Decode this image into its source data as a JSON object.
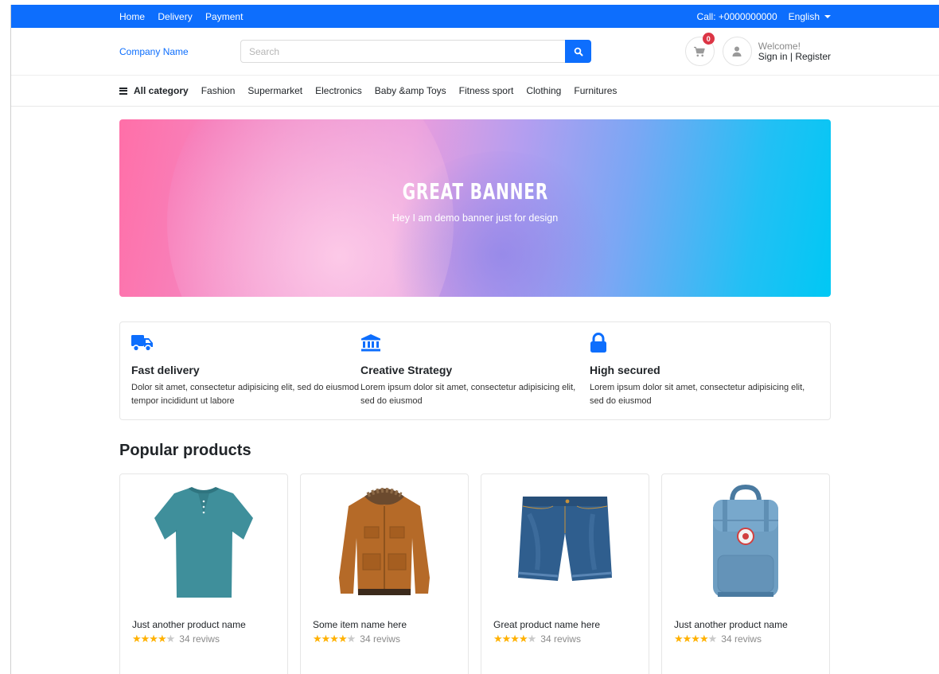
{
  "topbar": {
    "links": [
      "Home",
      "Delivery",
      "Payment"
    ],
    "call": "Call: +0000000000",
    "language": "English"
  },
  "header": {
    "brand": "Company Name",
    "search_placeholder": "Search",
    "cart_count": "0",
    "welcome": "Welcome!",
    "sign_in": "Sign in",
    "separator": "|",
    "register": "Register"
  },
  "categories": {
    "all": "All category",
    "items": [
      "Fashion",
      "Supermarket",
      "Electronics",
      "Baby &amp Toys",
      "Fitness sport",
      "Clothing",
      "Furnitures"
    ]
  },
  "banner": {
    "title": "GREAT BANNER",
    "subtitle": "Hey I am demo banner just for design"
  },
  "features": [
    {
      "icon": "truck-icon",
      "title": "Fast delivery",
      "desc": "Dolor sit amet, consectetur adipisicing elit, sed do eiusmod tempor incididunt ut labore"
    },
    {
      "icon": "bank-icon",
      "title": "Creative Strategy",
      "desc": "Lorem ipsum dolor sit amet, consectetur adipisicing elit, sed do eiusmod"
    },
    {
      "icon": "lock-icon",
      "title": "High secured",
      "desc": "Lorem ipsum dolor sit amet, consectetur adipisicing elit, sed do eiusmod"
    }
  ],
  "popular": {
    "title": "Popular products",
    "products": [
      {
        "name": "Just another product name",
        "rating": 4,
        "reviews": "34 reviws",
        "image": "polo-shirt"
      },
      {
        "name": "Some item name here",
        "rating": 4,
        "reviews": "34 reviws",
        "image": "jacket"
      },
      {
        "name": "Great product name here",
        "rating": 4,
        "reviews": "34 reviws",
        "image": "denim-shorts"
      },
      {
        "name": "Just another product name",
        "rating": 4,
        "reviews": "34 reviws",
        "image": "backpack"
      }
    ]
  },
  "colors": {
    "primary": "#0d6efd",
    "badge": "#dc3545",
    "star": "#ffb100"
  }
}
